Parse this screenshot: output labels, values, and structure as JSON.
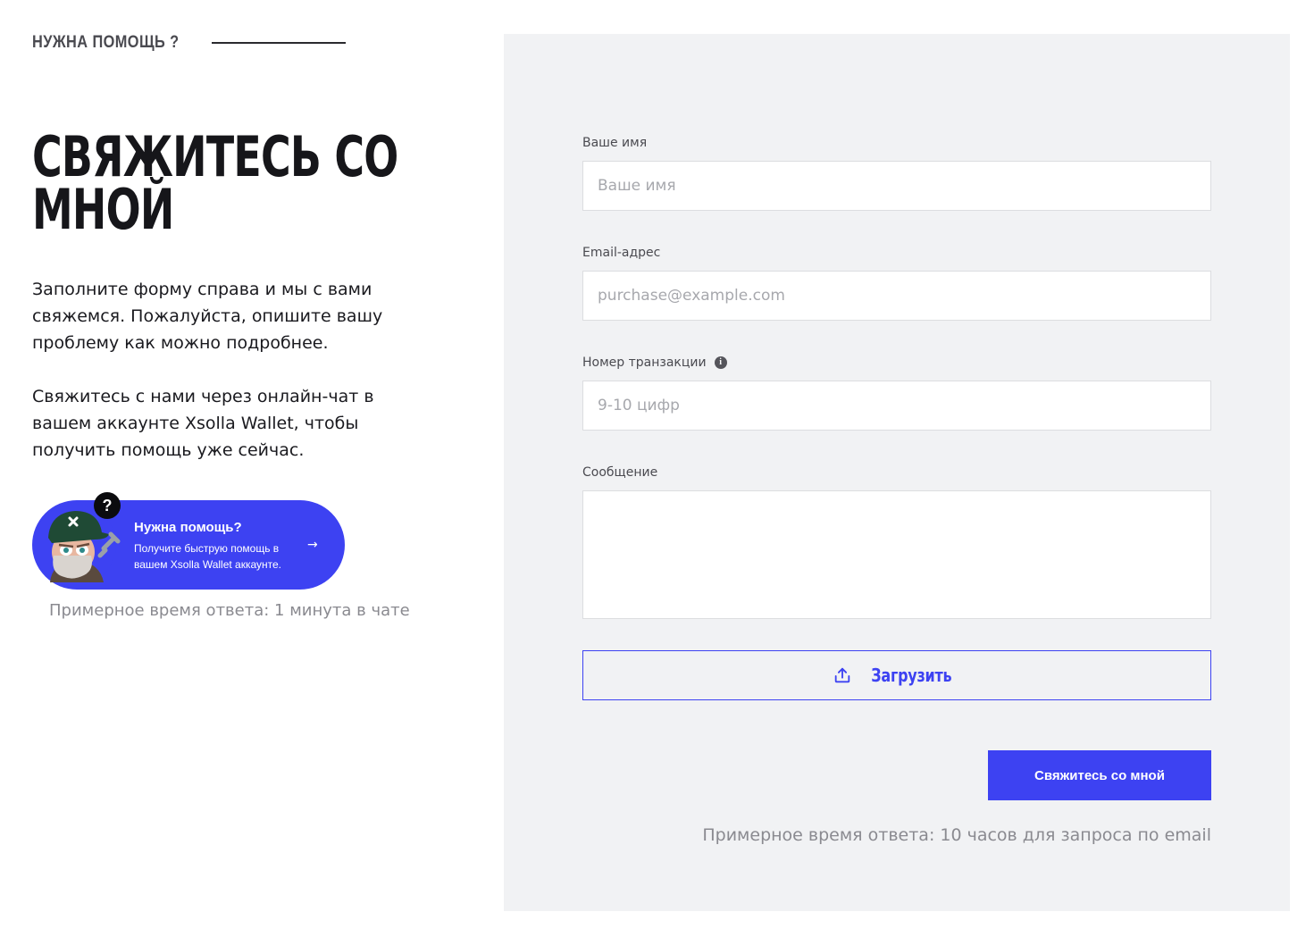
{
  "header": {
    "eyebrow": "НУЖНА ПОМОЩЬ ?"
  },
  "hero": {
    "title": "СВЯЖИТЕСЬ СО МНОЙ",
    "paragraph_1": "Заполните форму справа и мы с вами свяжемся. Пожалуйста, опишите вашу проблему как можно подробнее.",
    "paragraph_2": "Свяжитесь с нами через онлайн-чат в вашем аккаунте Xsolla Wallet, чтобы получить помощь уже сейчас."
  },
  "help_card": {
    "badge": "?",
    "title": "Нужна помощь?",
    "subtitle": "Получите быструю помощь в вашем Xsolla Wallet аккаунте.",
    "arrow": "→",
    "response_time": "Примерное время ответа: 1 минута в чате"
  },
  "form": {
    "name": {
      "label": "Ваше имя",
      "placeholder": "Ваше имя",
      "value": ""
    },
    "email": {
      "label": "Email-адрес",
      "placeholder": "purchase@example.com",
      "value": ""
    },
    "transaction": {
      "label": "Номер транзакции",
      "info_icon": "info-icon",
      "placeholder": "9-10 цифр",
      "value": ""
    },
    "message": {
      "label": "Сообщение",
      "placeholder": "",
      "value": ""
    },
    "upload_label": "Загрузить",
    "upload_icon": "upload-icon",
    "submit_label": "Свяжитесь со мной",
    "response_time": "Примерное время ответа: 10 часов для запроса по email"
  },
  "colors": {
    "accent": "#3d42f2",
    "panel_bg": "#f1f2f4",
    "muted_text": "#8a8a90"
  }
}
